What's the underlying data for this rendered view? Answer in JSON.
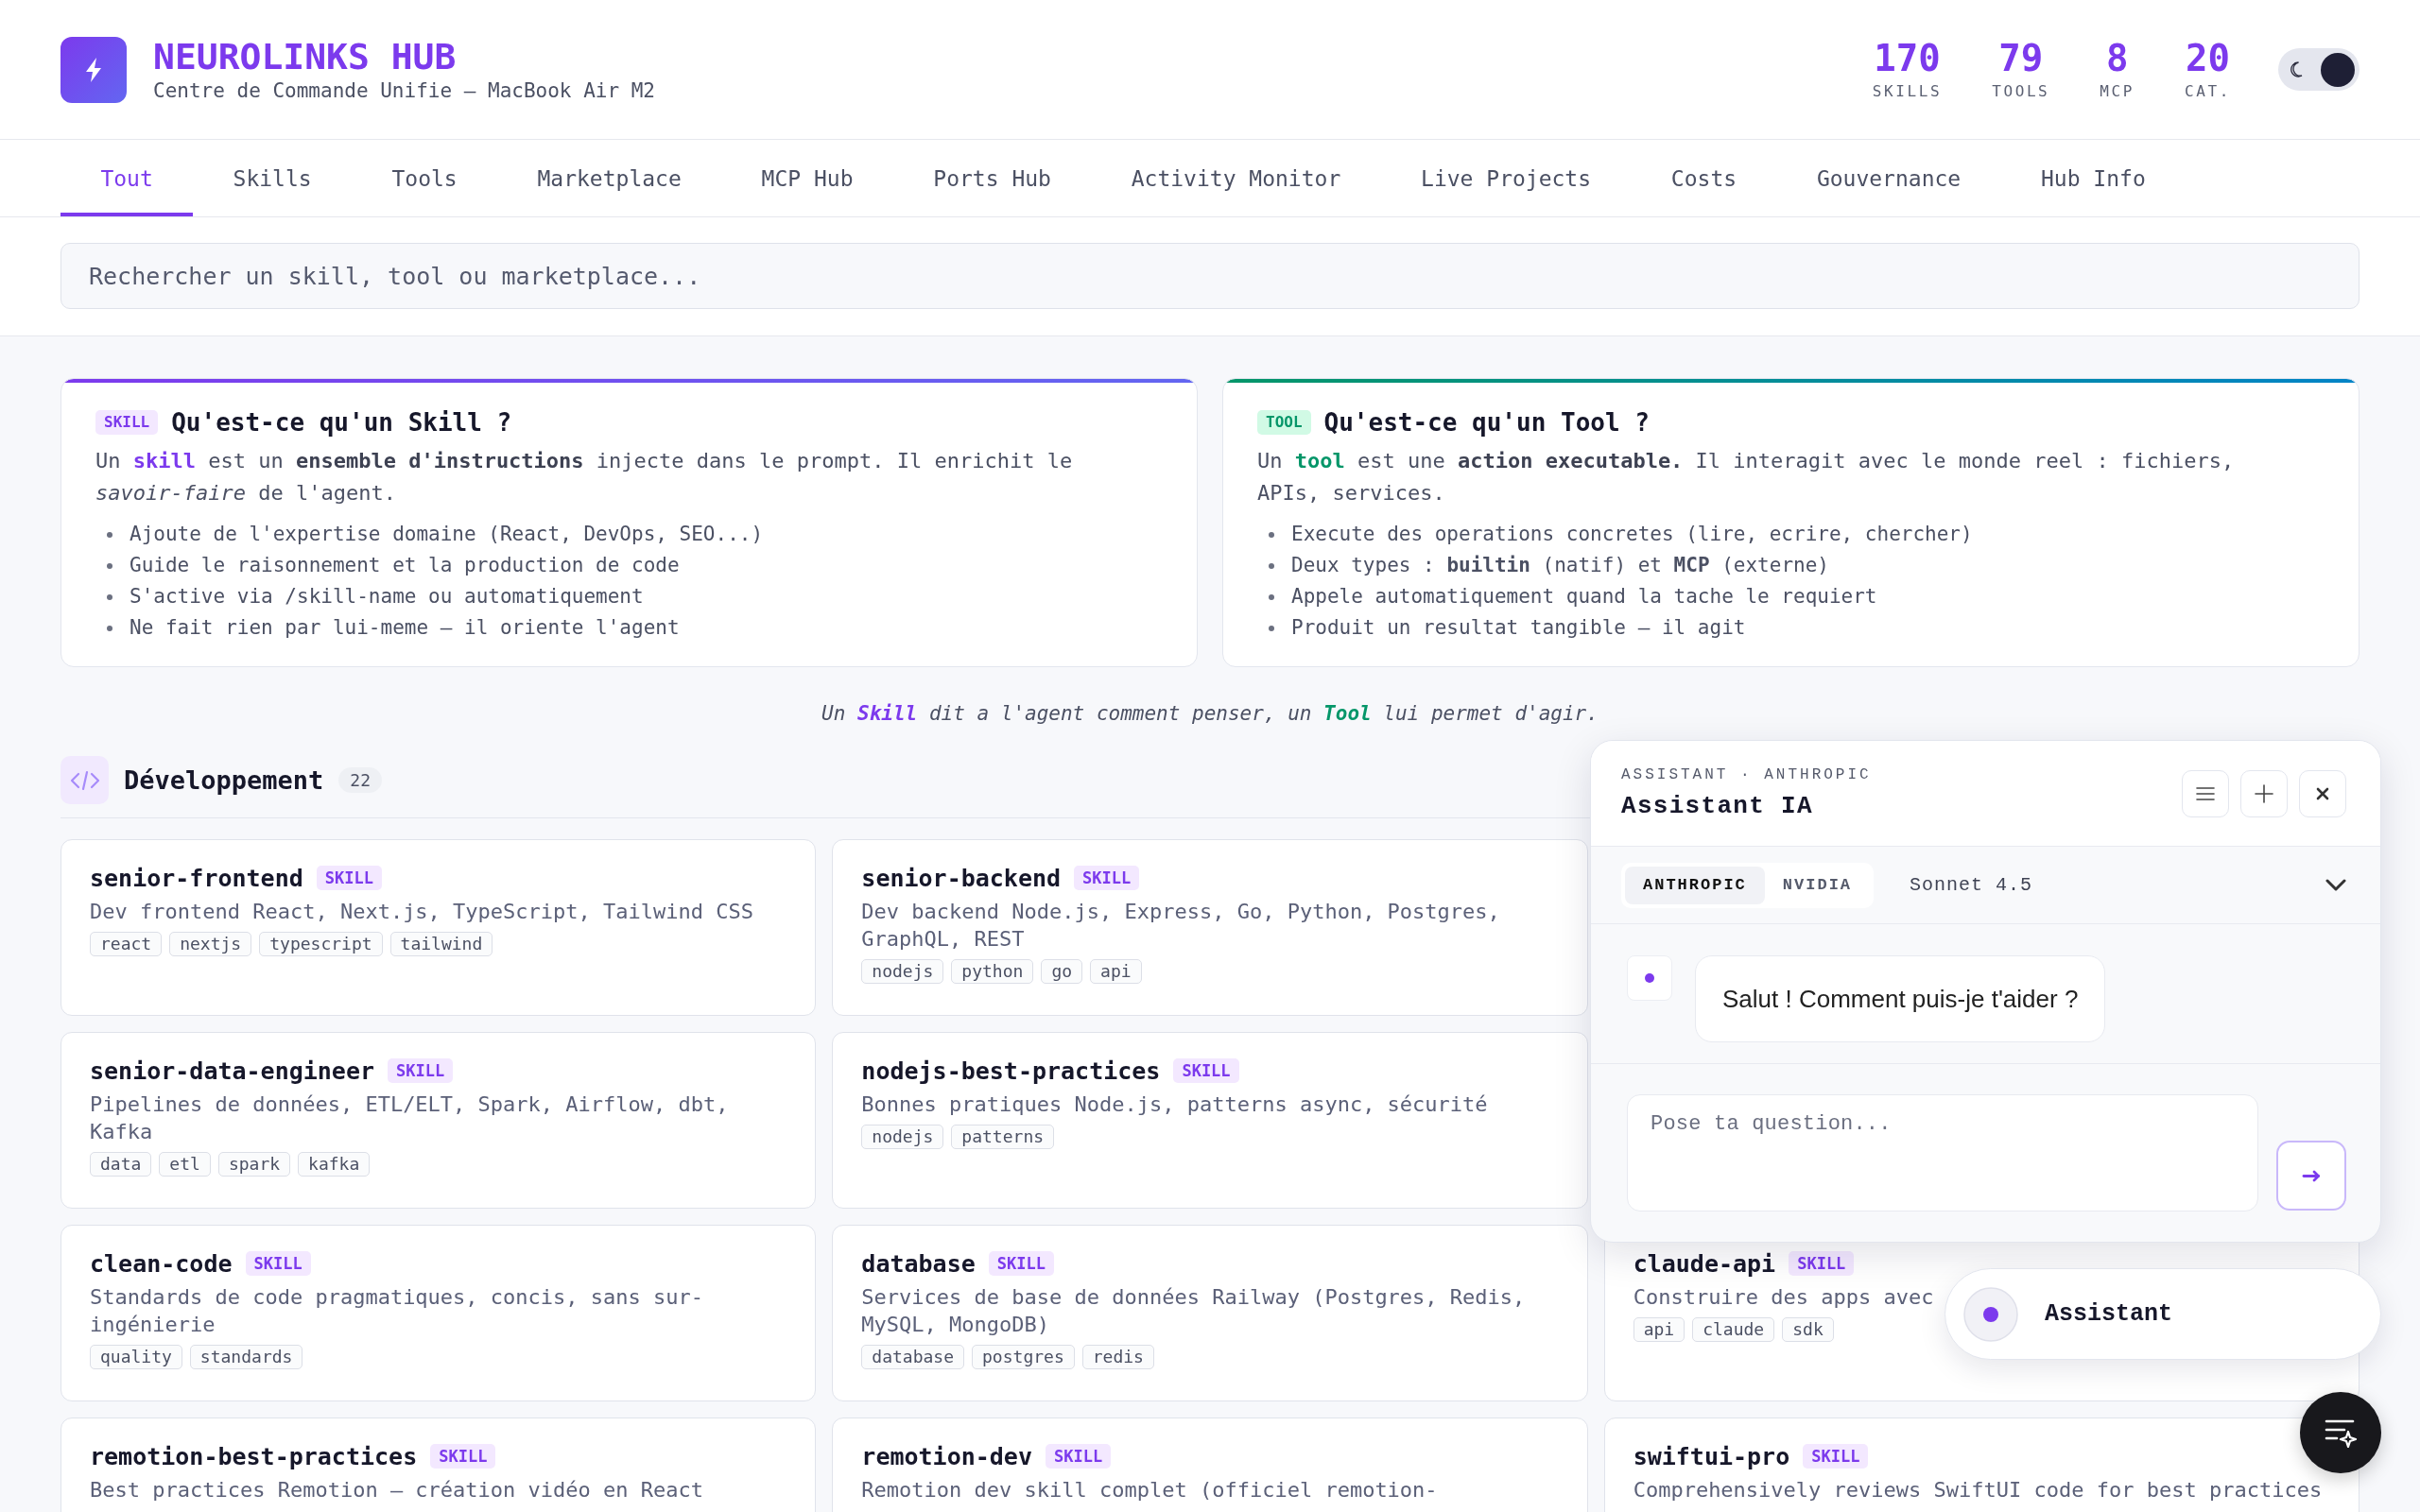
{
  "header": {
    "title": "NEUROLINKS HUB",
    "subtitle": "Centre de Commande Unifie — MacBook Air M2",
    "stats": [
      {
        "value": "170",
        "label": "SKILLS"
      },
      {
        "value": "79",
        "label": "TOOLS"
      },
      {
        "value": "8",
        "label": "MCP"
      },
      {
        "value": "20",
        "label": "CAT."
      }
    ],
    "theme_toggle": {
      "on": true
    }
  },
  "tabs": [
    {
      "label": "Tout",
      "selected": true
    },
    {
      "label": "Skills",
      "selected": false
    },
    {
      "label": "Tools",
      "selected": false
    },
    {
      "label": "Marketplace",
      "selected": false
    },
    {
      "label": "MCP Hub",
      "selected": false
    },
    {
      "label": "Ports Hub",
      "selected": false
    },
    {
      "label": "Activity Monitor",
      "selected": false
    },
    {
      "label": "Live Projects",
      "selected": false
    },
    {
      "label": "Costs",
      "selected": false
    },
    {
      "label": "Gouvernance",
      "selected": false
    },
    {
      "label": "Hub Info",
      "selected": false
    }
  ],
  "search": {
    "placeholder": "Rechercher un skill, tool ou marketplace..."
  },
  "intro_cards": [
    {
      "kind": "skill",
      "badge": "SKILL",
      "title": "Qu'est-ce qu'un Skill ?",
      "text": "Un **skill** est un **ensemble d'instructions** injecte dans le prompt. Il enrichit le *savoir-faire* de l'agent.",
      "bullets": [
        "Ajoute de l'expertise domaine (React, DevOps, SEO...)",
        "Guide le raisonnement et la production de code",
        "S'active via /skill-name ou automatiquement",
        "Ne fait rien par lui-meme — il oriente l'agent"
      ]
    },
    {
      "kind": "tool",
      "badge": "TOOL",
      "title": "Qu'est-ce qu'un Tool ?",
      "text": "Un **tool** est une **action executable.** Il interagit avec le monde reel : fichiers, APIs, services.",
      "bullets": [
        "Execute des operations concretes (lire, ecrire, chercher)",
        "Deux types : **builtin** (natif) et **MCP** (externe)",
        "Appele automatiquement quand la tache le requiert",
        "Produit un resultat tangible — il agit"
      ]
    }
  ],
  "tagline": "Un **Skill** dit a l'agent comment penser, un **Tool** lui permet d'agir.",
  "section": {
    "title": "Développement",
    "count": "22",
    "rows": [
      [
        {
          "name": "senior-frontend",
          "badge": "SKILL",
          "description": "Dev frontend React, Next.js, TypeScript, Tailwind CSS",
          "tags": [
            "react",
            "nextjs",
            "typescript",
            "tailwind"
          ]
        },
        {
          "name": "senior-backend",
          "badge": "SKILL",
          "description": "Dev backend Node.js, Express, Go, Python, Postgres, GraphQL, REST",
          "tags": [
            "nodejs",
            "python",
            "go",
            "api"
          ]
        }
      ],
      [
        {
          "name": "senior-data-engineer",
          "badge": "SKILL",
          "description": "Pipelines de données, ETL/ELT, Spark, Airflow, dbt, Kafka",
          "tags": [
            "data",
            "etl",
            "spark",
            "kafka"
          ]
        },
        {
          "name": "nodejs-best-practices",
          "badge": "SKILL",
          "description": "Bonnes pratiques Node.js, patterns async, sécurité",
          "tags": [
            "nodejs",
            "patterns"
          ]
        }
      ],
      [
        {
          "name": "clean-code",
          "badge": "SKILL",
          "description": "Standards de code pragmatiques, concis, sans sur-ingénierie",
          "tags": [
            "quality",
            "standards"
          ]
        },
        {
          "name": "database",
          "badge": "SKILL",
          "description": "Services de base de données Railway (Postgres, Redis, MySQL, MongoDB)",
          "tags": [
            "database",
            "postgres",
            "redis"
          ]
        },
        {
          "name": "claude-api",
          "badge": "SKILL",
          "description": "Construire des apps avec",
          "tags": [
            "api",
            "claude",
            "sdk"
          ]
        }
      ],
      [
        {
          "name": "remotion-best-practices",
          "badge": "SKILL",
          "description": "Best practices Remotion — création vidéo en React"
        },
        {
          "name": "remotion-dev",
          "badge": "SKILL",
          "description": "Remotion dev skill complet (officiel remotion-"
        },
        {
          "name": "swiftui-pro",
          "badge": "SKILL",
          "description": "Comprehensively reviews SwiftUI code for best practices"
        }
      ]
    ]
  },
  "assistant": {
    "eyebrow": "ASSISTANT · ANTHROPIC",
    "title": "Assistant IA",
    "providers": [
      {
        "label": "ANTHROPIC",
        "selected": true
      },
      {
        "label": "NVIDIA",
        "selected": false
      }
    ],
    "model": "Sonnet 4.5",
    "messages": [
      {
        "text": "Salut ! Comment puis-je t'aider ?"
      }
    ],
    "input": {
      "placeholder": "Pose ta question..."
    }
  },
  "launcher": {
    "label": "Assistant"
  }
}
